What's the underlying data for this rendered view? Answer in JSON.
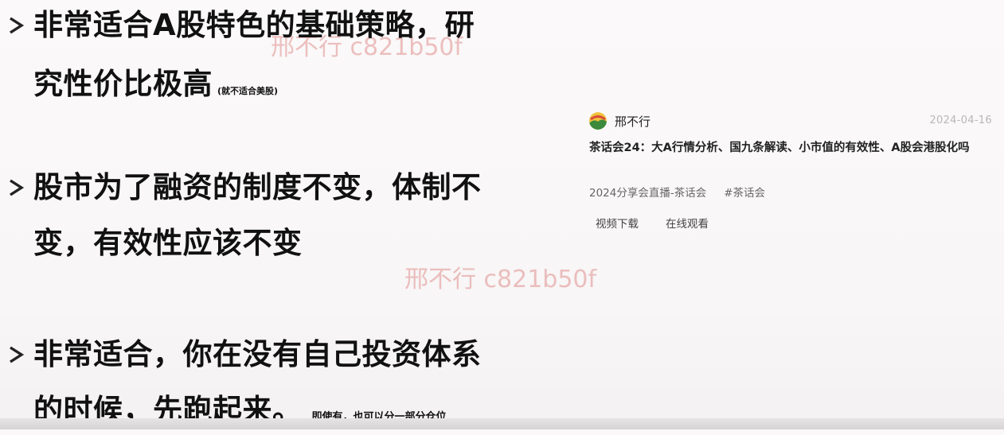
{
  "bullets": [
    {
      "lines": [
        "非常适合A股特色的基础策略，研",
        "究性价比极高"
      ],
      "note": "(就不适合美股)"
    },
    {
      "lines": [
        "股市为了融资的制度不变，体制不",
        "变，有效性应该不变"
      ],
      "note": ""
    },
    {
      "lines": [
        "非常适合，你在没有自己投资体系",
        "的时候，先跑起来。"
      ],
      "note": "即使有，也可以分一部分仓位"
    }
  ],
  "watermarks": [
    "邢不行 c821b50f",
    "邢不行 c821b50f"
  ],
  "card": {
    "author": "邢不行",
    "date": "2024-04-16",
    "title": "茶话会24：大A行情分析、国九条解读、小市值的有效性、A股会港股化吗",
    "tags": [
      "2024分享会直播-茶话会",
      "#茶话会"
    ],
    "actions": [
      "视频下载",
      "在线观看"
    ]
  },
  "colors": {
    "text": "#111111",
    "watermark": "#dc7878",
    "date": "#b8b8b8",
    "background": "#faf8f8"
  }
}
